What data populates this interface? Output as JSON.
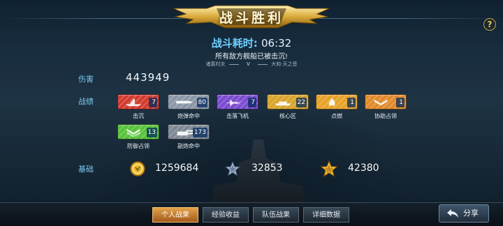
{
  "header": {
    "title": "战斗胜利",
    "help_label": "?"
  },
  "summary": {
    "time_label": "战斗耗时:",
    "time_value": "06:32",
    "result_text": "所有敌方舰船已被击沉!",
    "player_left": "诸葛村夫",
    "vs_label": "V",
    "player_right": "大和·天之音"
  },
  "damage": {
    "label": "伤害",
    "value": "443949"
  },
  "records": {
    "label": "战绩",
    "badges": [
      {
        "name": "击沉",
        "count": "7",
        "color": "#d23a2e",
        "icon": "sinking-ship-icon"
      },
      {
        "name": "炮弹命中",
        "count": "80",
        "color": "#8a96a6",
        "icon": "shell-hit-icon"
      },
      {
        "name": "击落飞机",
        "count": "7",
        "color": "#7a4ad0",
        "icon": "plane-shot-icon"
      },
      {
        "name": "核心区",
        "count": "22",
        "color": "#d8a42a",
        "icon": "core-zone-icon"
      },
      {
        "name": "点燃",
        "count": "1",
        "color": "#e6a228",
        "icon": "fire-icon"
      },
      {
        "name": "协助占领",
        "count": "1",
        "color": "#e08a2a",
        "icon": "assist-capture-icon"
      },
      {
        "name": "防御占领",
        "count": "13",
        "color": "#58c23a",
        "icon": "defend-capture-icon"
      },
      {
        "name": "副炮命中",
        "count": "173",
        "color": "#7d8894",
        "icon": "secondary-gun-icon"
      }
    ]
  },
  "base": {
    "label": "基础",
    "resources": [
      {
        "icon": "gold-coin-icon",
        "value": "1259684"
      },
      {
        "icon": "silver-star-icon",
        "value": "32853"
      },
      {
        "icon": "gold-star-icon",
        "value": "42380"
      }
    ]
  },
  "tabs": [
    {
      "label": "个人战果",
      "active": true
    },
    {
      "label": "经验收益",
      "active": false
    },
    {
      "label": "队伍战果",
      "active": false
    },
    {
      "label": "详细数据",
      "active": false
    }
  ],
  "share": {
    "label": "分享",
    "icon": "share-arrow-icon"
  }
}
